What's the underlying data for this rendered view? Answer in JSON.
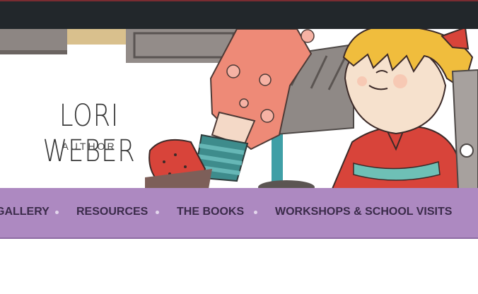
{
  "site": {
    "title": "LORI WEBER",
    "tagline": "AUTHOR"
  },
  "nav": {
    "items": [
      {
        "label": "GALLERY"
      },
      {
        "label": "RESOURCES"
      },
      {
        "label": "THE BOOKS"
      },
      {
        "label": "WORKSHOPS & SCHOOL VISITS"
      }
    ]
  },
  "colors": {
    "topbar": "#22272b",
    "nav_background": "#ad89c1",
    "nav_text": "#3b2b4a",
    "title_text": "#3a3a3a"
  }
}
